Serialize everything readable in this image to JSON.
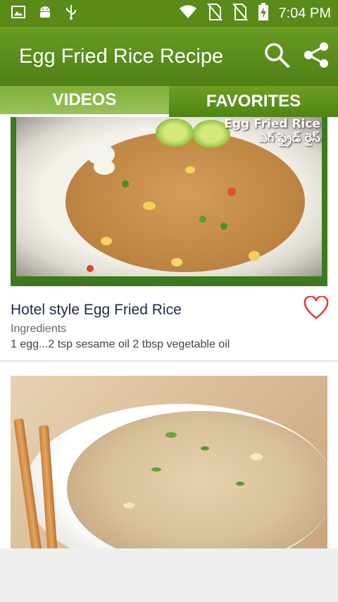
{
  "status_bar": {
    "time": "7:04 PM",
    "icons": [
      "image-icon",
      "android-icon",
      "usb-icon",
      "wifi-icon",
      "no-sim-icon",
      "no-sim-icon",
      "battery-charging-icon"
    ]
  },
  "app_bar": {
    "title": "Egg Fried Rice Recipe",
    "actions": [
      "search-icon",
      "share-icon"
    ]
  },
  "tabs": [
    {
      "label": "VIDEOS",
      "selected": true
    },
    {
      "label": "FAVORITES",
      "selected": false
    }
  ],
  "videos": [
    {
      "thumbnail_caption_line1": "Egg Fried Rice",
      "thumbnail_caption_line2": "ఎగ్ ఫ్రైడ్ రైస్",
      "title": "Hotel style Egg Fried Rice",
      "subtitle": "Ingredients",
      "description": "1 egg...2 tsp sesame oil 2 tbsp vegetable oil",
      "favorite": false
    },
    {
      "title": "",
      "subtitle": "",
      "description": ""
    }
  ],
  "colors": {
    "app_bar": "#5a8a18",
    "tab_selected": "#8bb84a",
    "tab_unselected": "#5a8d1a",
    "heart": "#e53935",
    "title_text": "#1d2b4a"
  }
}
